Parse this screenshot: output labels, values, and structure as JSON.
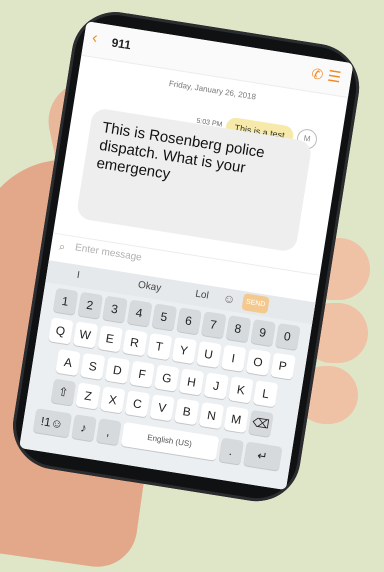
{
  "header": {
    "title": "911"
  },
  "conversation": {
    "date": "Friday, January 26, 2018",
    "time": "5:03 PM",
    "sent_message": "This is a test",
    "avatar": "M",
    "received_message": "This is Rosenberg police dispatch. What is your emergency"
  },
  "input": {
    "placeholder": "Enter message"
  },
  "keyboard": {
    "suggestions": [
      "I",
      "Okay",
      "Lol"
    ],
    "send_label": "SEND",
    "number_row": [
      "1",
      "2",
      "3",
      "4",
      "5",
      "6",
      "7",
      "8",
      "9",
      "0"
    ],
    "row1": [
      "Q",
      "W",
      "E",
      "R",
      "T",
      "Y",
      "U",
      "I",
      "O",
      "P"
    ],
    "row2": [
      "A",
      "S",
      "D",
      "F",
      "G",
      "H",
      "J",
      "K",
      "L"
    ],
    "row3": [
      "Z",
      "X",
      "C",
      "V",
      "B",
      "N",
      "M"
    ],
    "symbols_key": "!1☺",
    "space_label": "English (US)",
    "period_key": "."
  },
  "colors": {
    "accent": "#f08a24",
    "sent_bubble": "#f6e9a9",
    "received_bubble": "#eeeeee"
  }
}
